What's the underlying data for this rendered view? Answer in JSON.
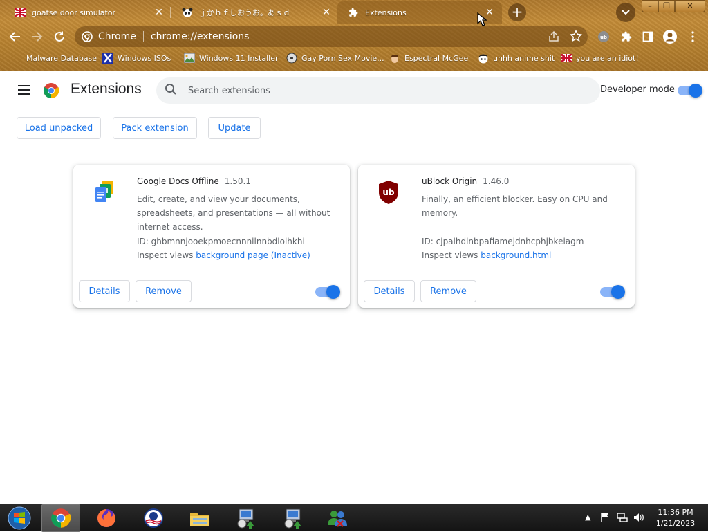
{
  "tabs": [
    {
      "title": "goatse door simulator",
      "icon": "flag-icon"
    },
    {
      "title": "ｊかｈｆしおうお。あｓｄ",
      "icon": "panda-icon"
    },
    {
      "title": "Extensions",
      "icon": "puzzle-icon"
    }
  ],
  "window_controls": {
    "minimize": "–",
    "maximize": "❐",
    "close": "✕"
  },
  "omnibox": {
    "site_label": "Chrome",
    "url": "chrome://extensions"
  },
  "bookmarks": [
    {
      "label": "Malware Database"
    },
    {
      "label": "Windows ISOs"
    },
    {
      "label": "Windows 11 Installer"
    },
    {
      "label": "Gay Porn Sex Movie..."
    },
    {
      "label": "Espectral McGee"
    },
    {
      "label": "uhhh anime shit"
    },
    {
      "label": "you are an idiot!"
    }
  ],
  "page": {
    "title": "Extensions",
    "search_placeholder": "Search extensions",
    "developer_mode_label": "Developer mode",
    "developer_mode_on": true,
    "buttons": {
      "load_unpacked": "Load unpacked",
      "pack_extension": "Pack extension",
      "update": "Update"
    }
  },
  "extensions": [
    {
      "name": "Google Docs Offline",
      "version": "1.50.1",
      "description": "Edit, create, and view your documents, spreadsheets, and presentations — all without internet access.",
      "id_label": "ID: ghbmnnjooekpmoecnnnilnnbdlolhkhi",
      "inspect_label": "Inspect views",
      "inspect_link": "background page (Inactive)",
      "details": "Details",
      "remove": "Remove",
      "enabled": true
    },
    {
      "name": "uBlock Origin",
      "version": "1.46.0",
      "description": "Finally, an efficient blocker. Easy on CPU and memory.",
      "id_label": "ID: cjpalhdlnbpafiamejdnhcphjbkeiagm",
      "inspect_label": "Inspect views",
      "inspect_link": "background.html",
      "details": "Details",
      "remove": "Remove",
      "enabled": true
    }
  ],
  "taskbar": {
    "time": "11:36 PM",
    "date": "1/21/2023",
    "apps": [
      "windows-start-icon",
      "chrome-icon",
      "firefox-icon",
      "obama-logo-icon",
      "file-explorer-icon",
      "network-installer-icon",
      "network-installer-icon",
      "msn-messenger-icon"
    ]
  },
  "colors": {
    "accent": "#1a73e8",
    "frame": "#b8822f"
  }
}
